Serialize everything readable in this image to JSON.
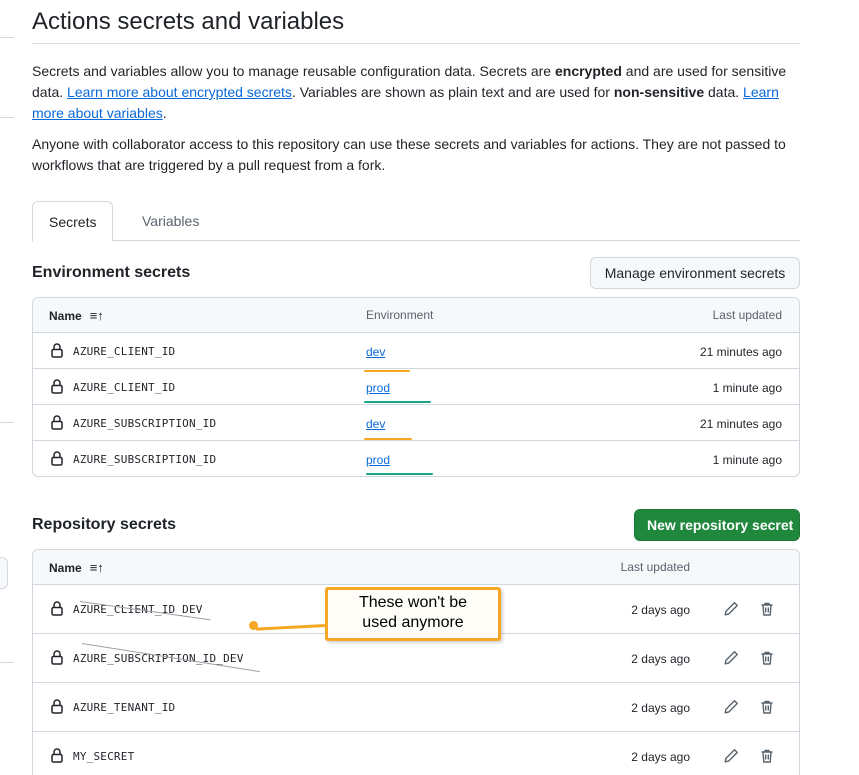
{
  "page": {
    "title": "Actions secrets and variables",
    "intro": {
      "t1": "Secrets and variables allow you to manage reusable configuration data. Secrets are ",
      "b1": "encrypted",
      "t2": " and are used for sensitive data. ",
      "link1": "Learn more about encrypted secrets",
      "t3": ". Variables are shown as plain text and are used for ",
      "b2": "non-sensitive",
      "t4": " data. ",
      "link2": "Learn more about variables",
      "t5": "."
    },
    "access_note": "Anyone with collaborator access to this repository can use these secrets and variables for actions. They are not passed to workflows that are triggered by a pull request from a fork."
  },
  "tabs": [
    {
      "label": "Secrets",
      "active": true
    },
    {
      "label": "Variables",
      "active": false
    }
  ],
  "environment_secrets": {
    "heading": "Environment secrets",
    "manage_button": "Manage environment secrets",
    "columns": {
      "name": "Name",
      "environment": "Environment",
      "last_updated": "Last updated"
    },
    "rows": [
      {
        "name": "AZURE_CLIENT_ID",
        "environment": "dev",
        "updated": "21 minutes ago"
      },
      {
        "name": "AZURE_CLIENT_ID",
        "environment": "prod",
        "updated": "1 minute ago"
      },
      {
        "name": "AZURE_SUBSCRIPTION_ID",
        "environment": "dev",
        "updated": "21 minutes ago"
      },
      {
        "name": "AZURE_SUBSCRIPTION_ID",
        "environment": "prod",
        "updated": "1 minute ago"
      }
    ]
  },
  "repository_secrets": {
    "heading": "Repository secrets",
    "new_button": "New repository secret",
    "columns": {
      "name": "Name",
      "last_updated": "Last updated"
    },
    "rows": [
      {
        "name": "AZURE_CLIENT_ID_DEV",
        "updated": "2 days ago"
      },
      {
        "name": "AZURE_SUBSCRIPTION_ID_DEV",
        "updated": "2 days ago"
      },
      {
        "name": "AZURE_TENANT_ID",
        "updated": "2 days ago"
      },
      {
        "name": "MY_SECRET",
        "updated": "2 days ago"
      }
    ]
  },
  "annotation": {
    "line1": "These won't be",
    "line2": "used anymore"
  },
  "icons": {
    "lock": "lock-icon",
    "sort": "sort-ascending-icon",
    "edit": "pencil-icon",
    "delete": "trash-icon"
  },
  "colors": {
    "link": "#0969da",
    "primary_button": "#1f883d",
    "highlight_dev": "#f5a623",
    "highlight_prod": "#1aa58b"
  }
}
